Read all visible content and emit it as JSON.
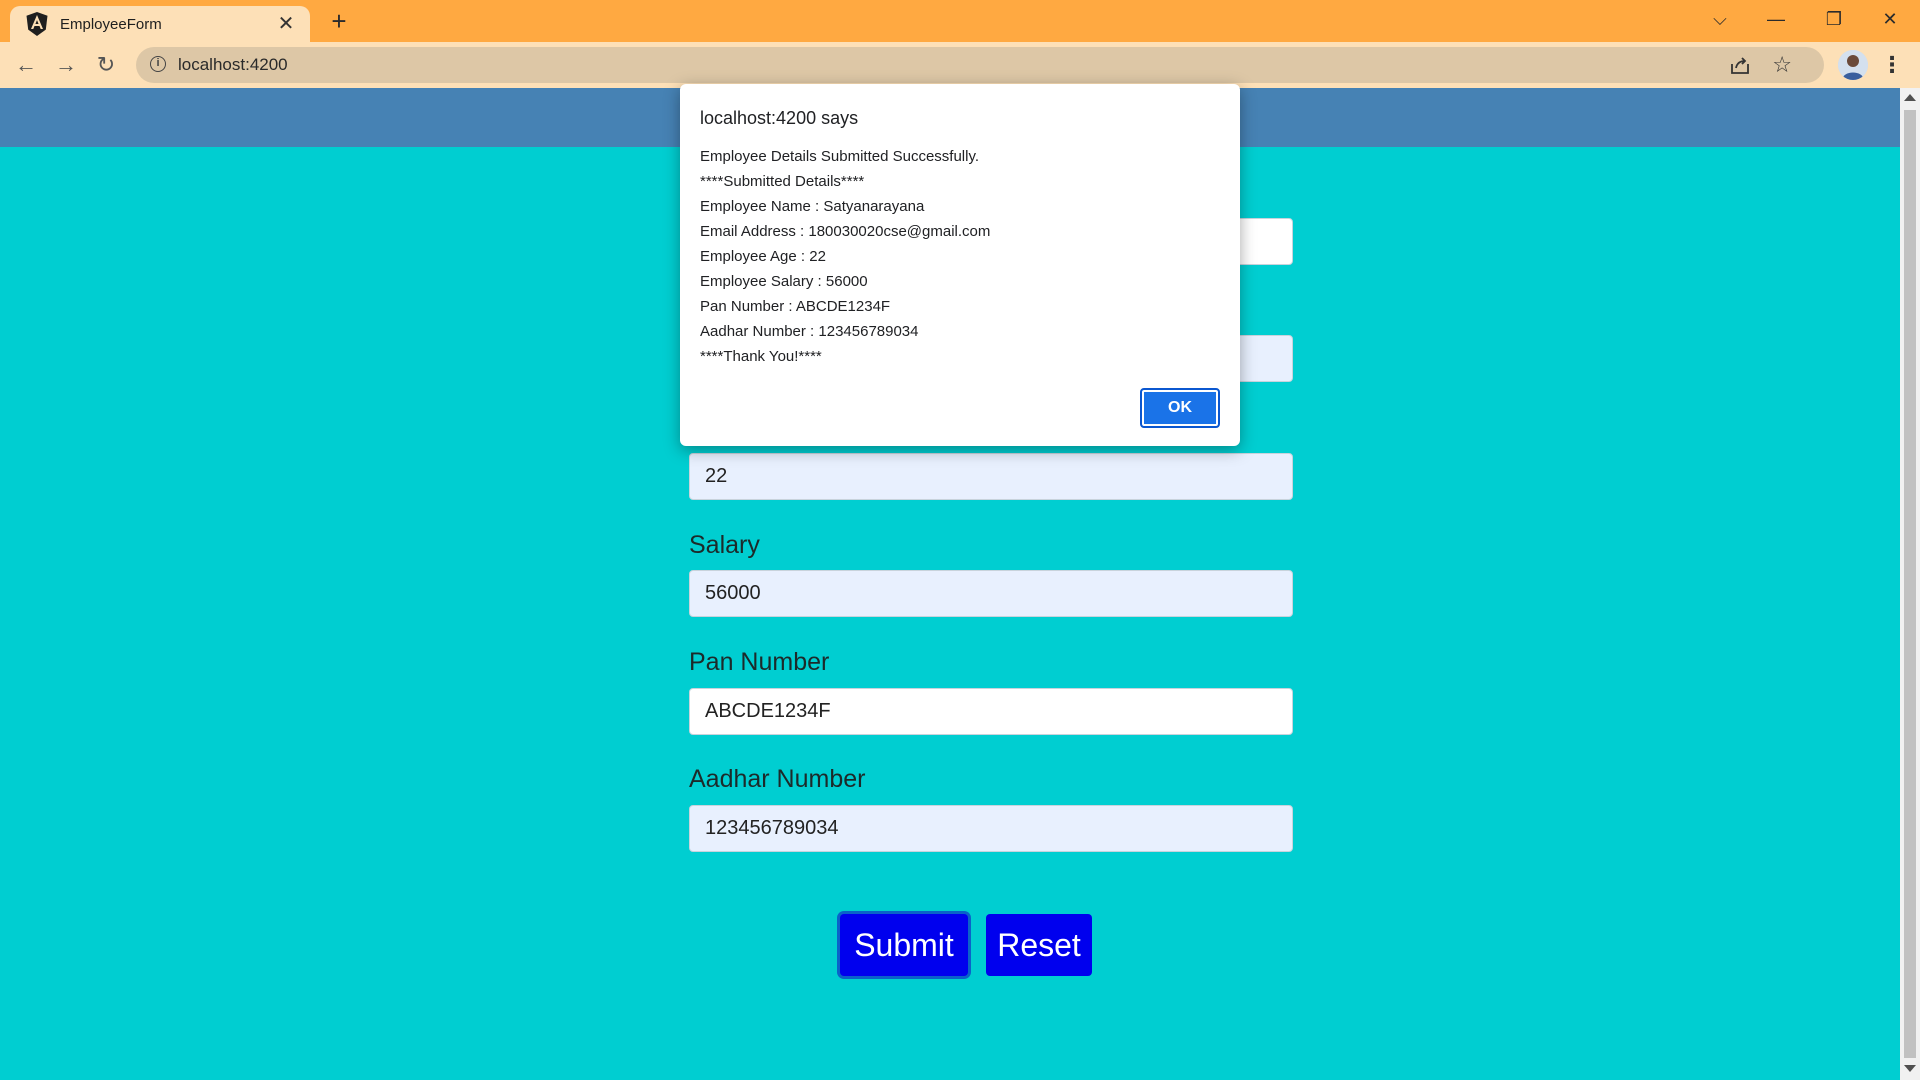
{
  "browser": {
    "tab_title": "EmployeeForm",
    "tab_close": "✕",
    "new_tab": "+",
    "url": "localhost:4200",
    "controls": {
      "dropdown": "⌵",
      "minimize": "—",
      "restore": "❐",
      "close": "✕"
    },
    "nav": {
      "back": "←",
      "forward": "→",
      "reload": "↻"
    },
    "star": "☆",
    "menu": "⋮"
  },
  "form": {
    "age_value": "22",
    "salary": {
      "label": "Salary",
      "value": "56000"
    },
    "pan": {
      "label": "Pan Number",
      "value": "ABCDE1234F"
    },
    "aadhar": {
      "label": "Aadhar Number",
      "value": "123456789034"
    },
    "submit_label": "Submit",
    "reset_label": "Reset"
  },
  "dialog": {
    "title": "localhost:4200 says",
    "lines": [
      "Employee Details Submitted Successfully.",
      "****Submitted Details****",
      "Employee Name : Satyanarayana",
      "Email Address : 180030020cse@gmail.com",
      "Employee Age : 22",
      "Employee Salary : 56000",
      "Pan Number : ABCDE1234F",
      "Aadhar Number : 123456789034",
      "****Thank You!****"
    ],
    "ok_label": "OK"
  },
  "colors": {
    "page_background": "#00ced1",
    "header": "#4682b4",
    "button": "#0000ee",
    "tabbar": "#ffa941"
  }
}
